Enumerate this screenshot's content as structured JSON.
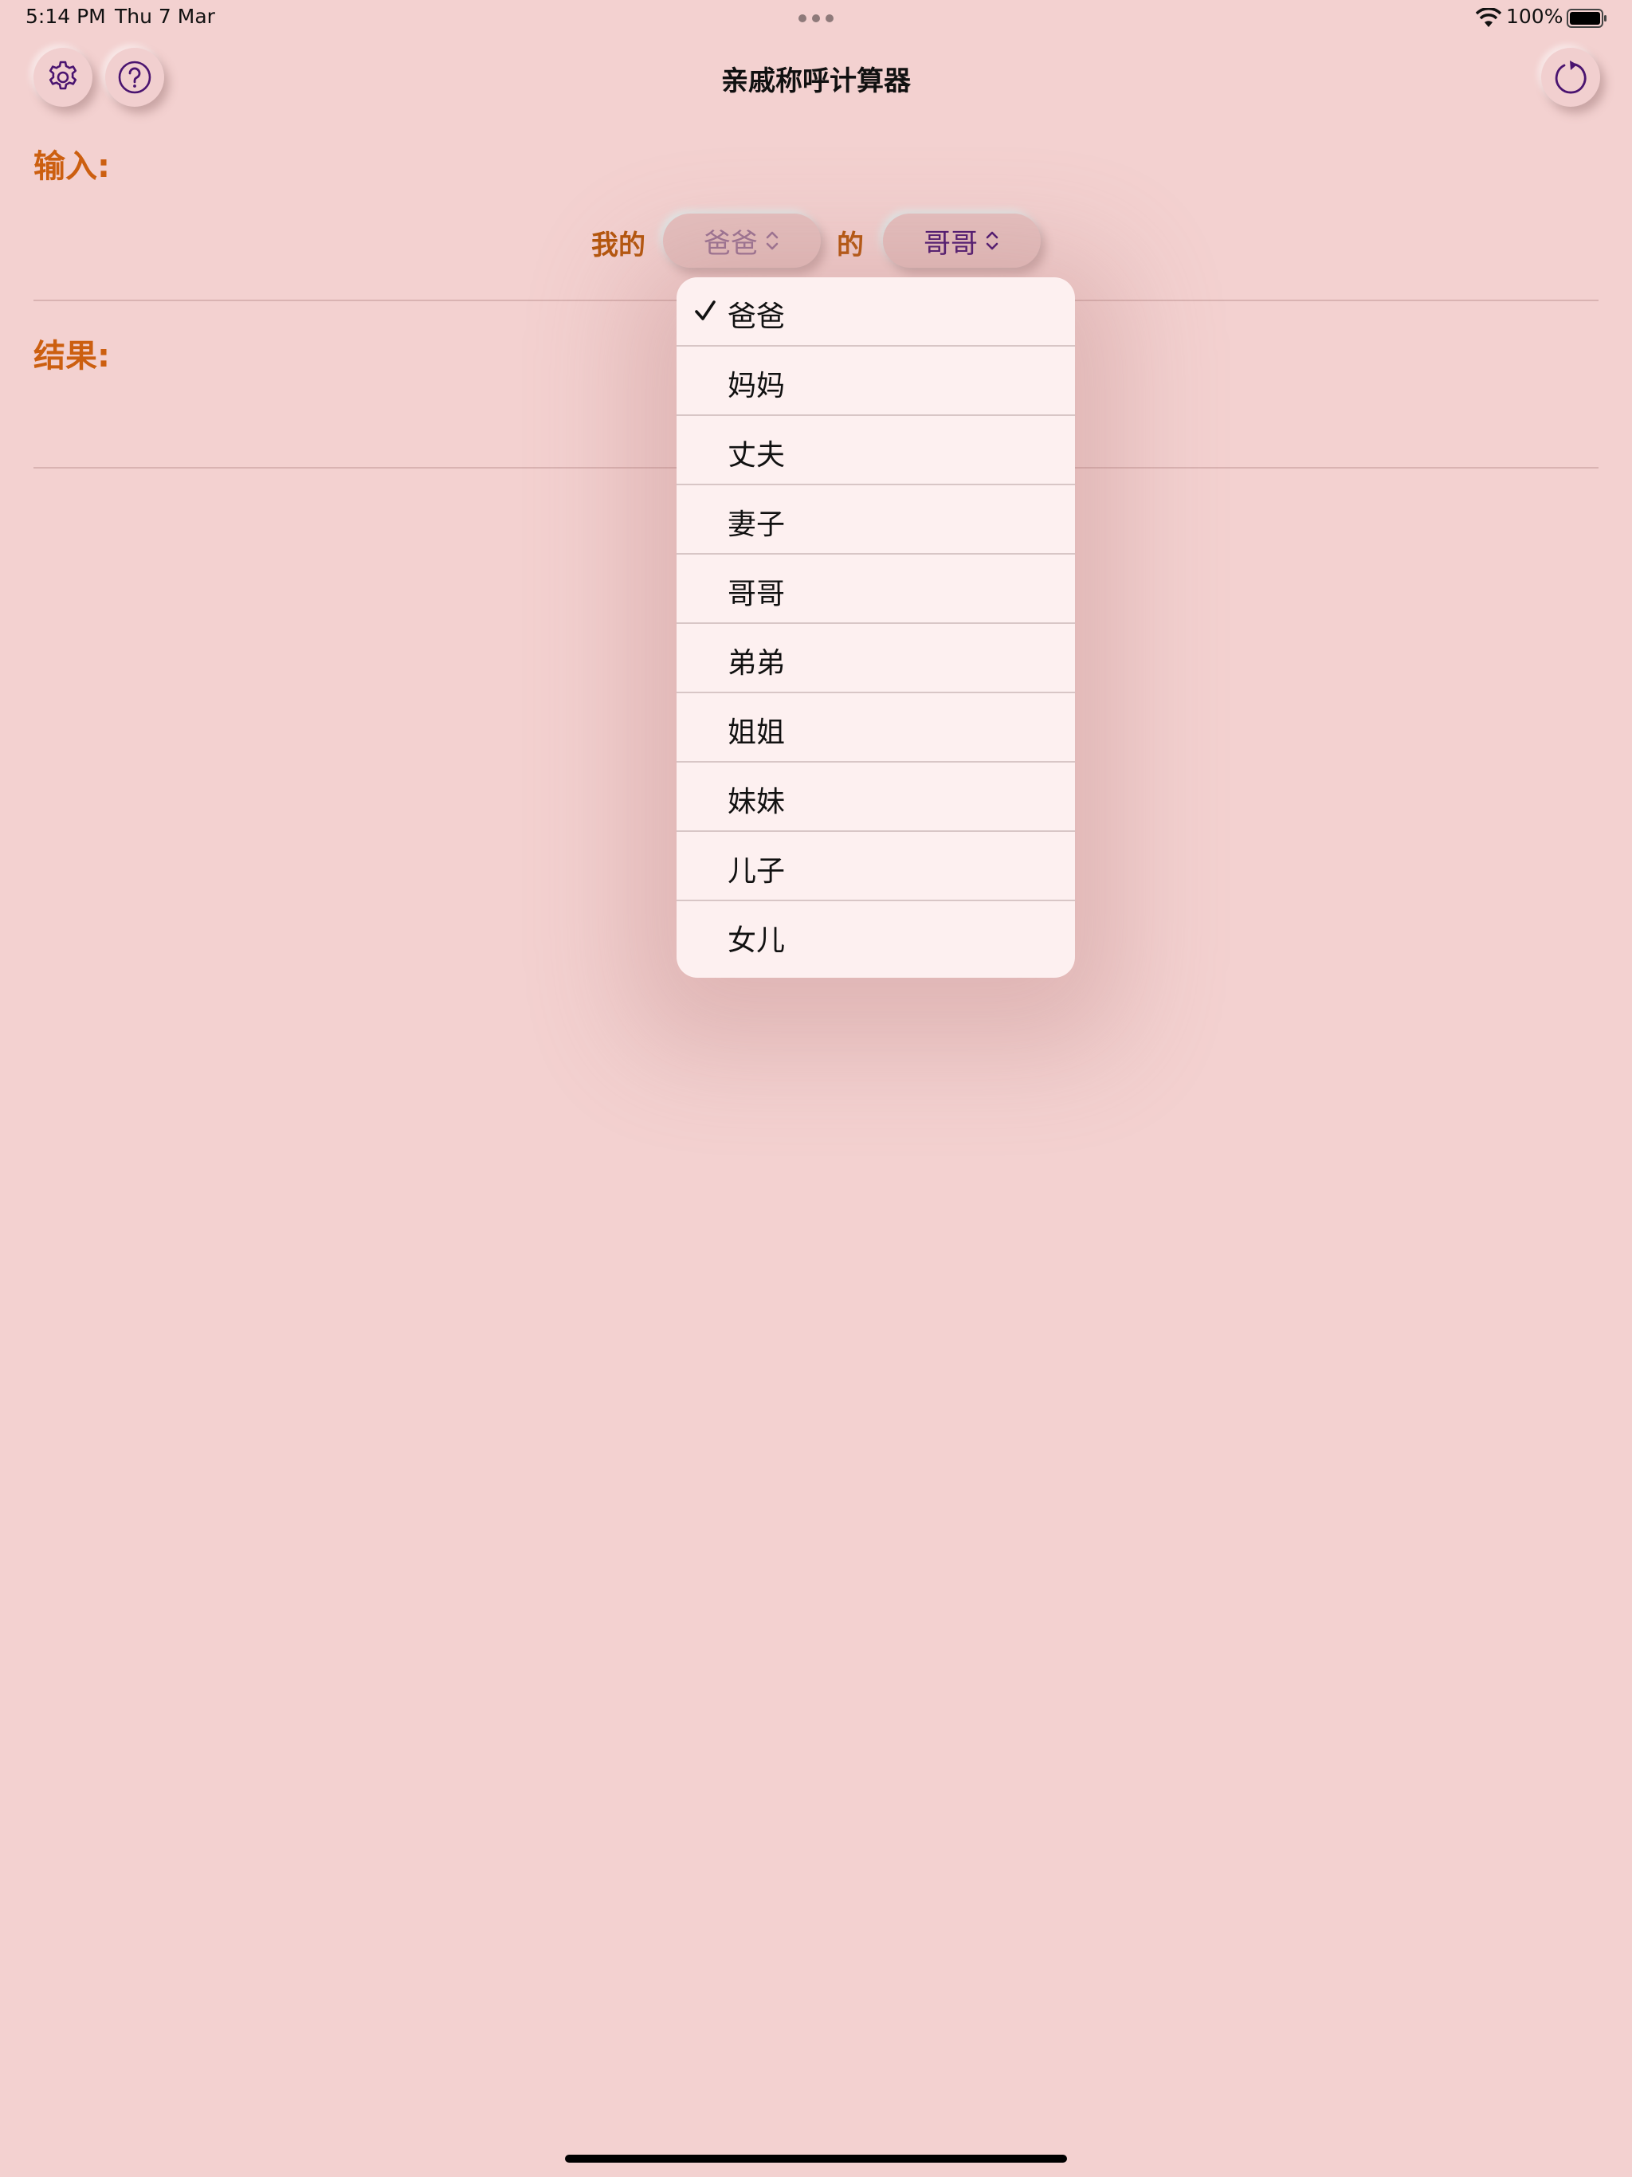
{
  "status_bar": {
    "time": "5:14 PM",
    "date": "Thu 7 Mar",
    "battery": "100%"
  },
  "header": {
    "title": "亲戚称呼计算器"
  },
  "icons": {
    "settings": "gear-icon",
    "help": "question-mark-icon",
    "reset": "refresh-icon"
  },
  "input": {
    "label": "输入:",
    "prefix": "我的",
    "connector": "的",
    "picker1_value": "爸爸",
    "picker2_value": "哥哥"
  },
  "result": {
    "label": "结果:"
  },
  "dropdown": {
    "selected": "爸爸",
    "options": [
      "爸爸",
      "妈妈",
      "丈夫",
      "妻子",
      "哥哥",
      "弟弟",
      "姐姐",
      "妹妹",
      "儿子",
      "女儿"
    ]
  },
  "colors": {
    "background": "#f3d1d0",
    "label_orange": "#cc5f10",
    "accent_purple": "#4a1470"
  }
}
